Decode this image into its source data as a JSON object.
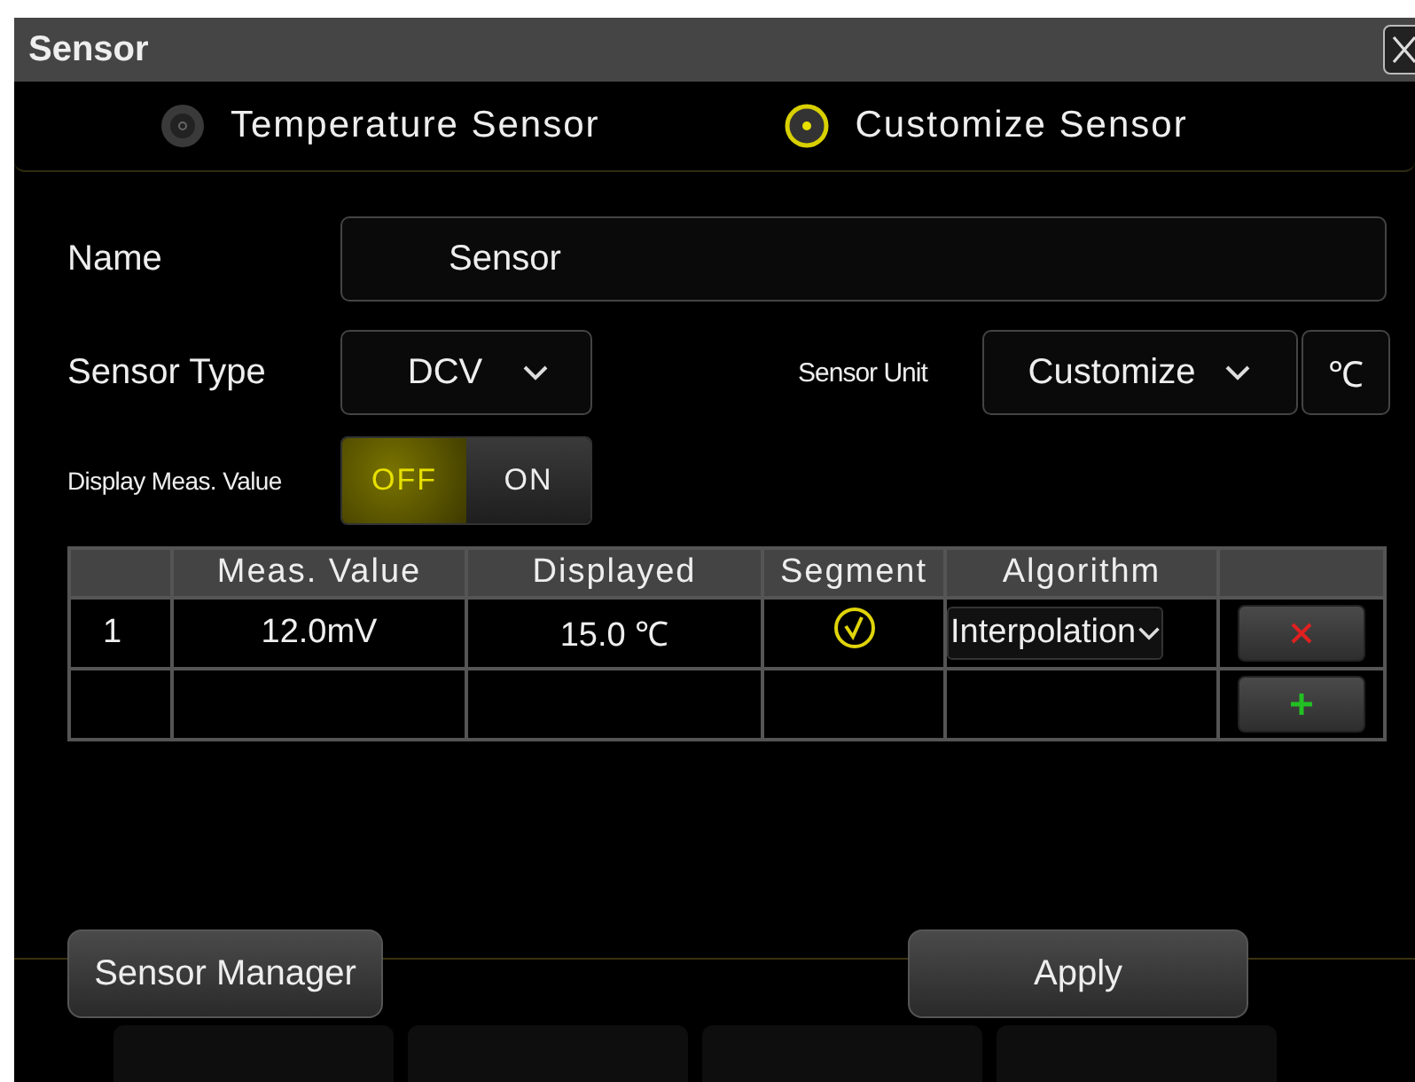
{
  "window": {
    "title": "Sensor"
  },
  "sensor_mode": [
    {
      "label": "Temperature Sensor",
      "selected": false
    },
    {
      "label": "Customize Sensor",
      "selected": true
    }
  ],
  "name": {
    "label": "Name",
    "value": "Sensor"
  },
  "sensor_type": {
    "label": "Sensor Type",
    "value": "DCV"
  },
  "sensor_unit": {
    "label": "Sensor Unit",
    "value": "Customize",
    "unit": "℃"
  },
  "display_meas_value": {
    "label": "Display Meas. Value",
    "options": [
      {
        "label": "OFF",
        "selected": true
      },
      {
        "label": "ON",
        "selected": false
      }
    ]
  },
  "table": {
    "columns": [
      "Meas. Value",
      "Displayed",
      "Segment",
      "Algorithm"
    ],
    "rows": [
      {
        "index": "1",
        "meas_value": "12.0mV",
        "displayed": "15.0 ℃",
        "segment": true,
        "algorithm": "Interpolation"
      }
    ]
  },
  "buttons": [
    "Sensor Manager",
    "Apply"
  ]
}
